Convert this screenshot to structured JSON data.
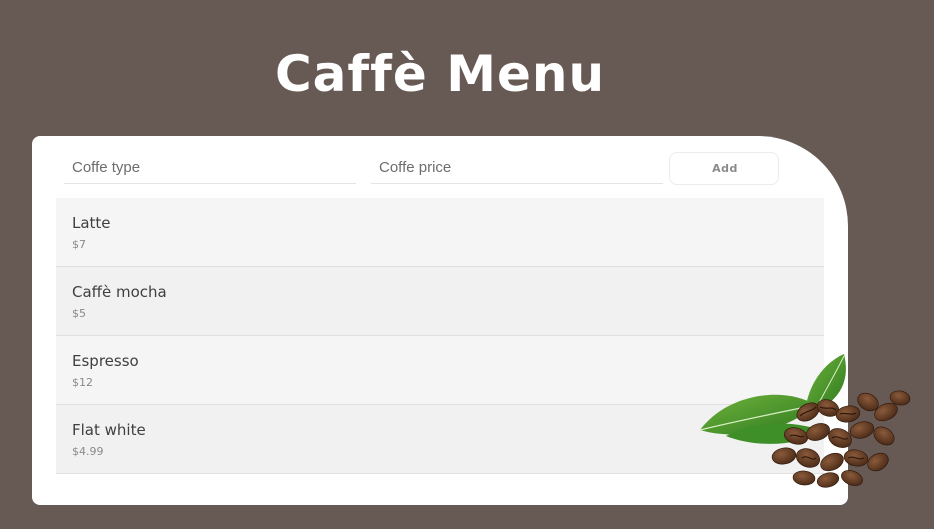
{
  "header": {
    "title": "Caffè Menu"
  },
  "form": {
    "type_placeholder": "Coffe type",
    "price_placeholder": "Coffe price",
    "add_label": "Add"
  },
  "menu": {
    "items": [
      {
        "name": "Latte",
        "price": "$7"
      },
      {
        "name": "Caffè mocha",
        "price": "$5"
      },
      {
        "name": "Espresso",
        "price": "$12"
      },
      {
        "name": "Flat white",
        "price": "$4.99"
      }
    ]
  },
  "decoration": {
    "image": "coffee-beans-with-leaves-icon"
  },
  "colors": {
    "background": "#675953",
    "card": "#ffffff",
    "title": "#ffffff"
  }
}
